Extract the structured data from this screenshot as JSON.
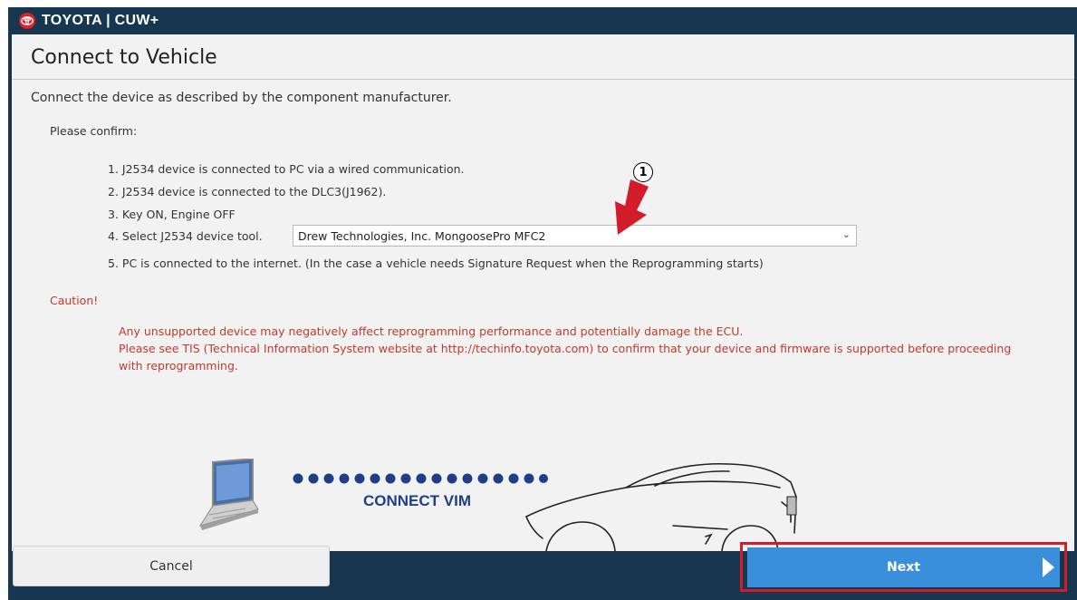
{
  "app": {
    "brand": "TOYOTA | CUW+"
  },
  "page": {
    "title": "Connect to Vehicle",
    "intro": "Connect the device as described by the component manufacturer.",
    "confirm_label": "Please confirm:",
    "steps": [
      "1. J2534 device is connected to PC via a wired communication.",
      "2. J2534 device is connected to the DLC3(J1962).",
      "3. Key ON, Engine OFF",
      "4. Select J2534 device tool.",
      "5. PC is connected to the internet. (In the case a vehicle needs Signature Request when the Reprogramming starts)"
    ],
    "device_select": {
      "value": "Drew Technologies, Inc. MongoosePro MFC2"
    },
    "caution_title": "Caution!",
    "caution_lines": [
      "Any unsupported device may negatively affect reprogramming performance and potentially damage the ECU.",
      "Please see TIS (Technical Information System website at http://techinfo.toyota.com) to confirm that your device and firmware is supported before proceeding with reprogramming."
    ],
    "illustration": {
      "label": "CONNECT VIM",
      "icons": [
        "laptop-icon",
        "car-icon"
      ]
    }
  },
  "annotation": {
    "number": "1"
  },
  "footer": {
    "cancel_label": "Cancel",
    "next_label": "Next"
  },
  "colors": {
    "header_bg": "#17364f",
    "accent_blue": "#3a8fdb",
    "caution_red": "#c0392b",
    "highlight_red": "#d21c2a",
    "dot_blue": "#1e3f86"
  }
}
